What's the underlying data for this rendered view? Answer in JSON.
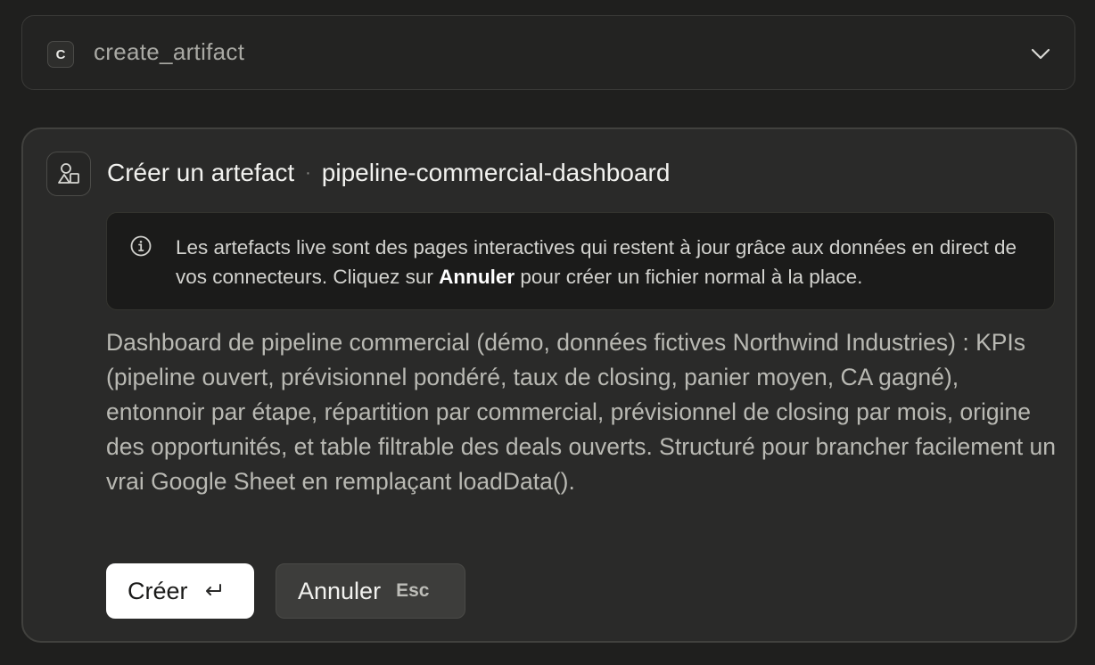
{
  "tool_call": {
    "badge": "C",
    "name": "create_artifact",
    "expand_icon": "chevron-down-icon"
  },
  "card": {
    "icon": "artifact-shapes-icon",
    "title": "Créer un artefact",
    "separator": "·",
    "artifact_id": "pipeline-commercial-dashboard",
    "info": {
      "icon": "info-icon",
      "text_before": "Les artefacts live sont des pages interactives qui restent à jour grâce aux données en direct de vos connecteurs. Cliquez sur ",
      "text_bold": "Annuler",
      "text_after": " pour créer un fichier normal à la place."
    },
    "description": "Dashboard de pipeline commercial (démo, données fictives Northwind Industries) : KPIs (pipeline ouvert, prévisionnel pondéré, taux de closing, panier moyen, CA gagné), entonnoir par étape, répartition par commercial, prévisionnel de closing par mois, origine des opportunités, et table filtrable des deals ouverts. Structuré pour brancher facilement un vrai Google Sheet en remplaçant loadData().",
    "buttons": {
      "create_label": "Créer",
      "create_icon": "enter-key-icon",
      "cancel_label": "Annuler",
      "cancel_shortcut": "Esc"
    }
  }
}
